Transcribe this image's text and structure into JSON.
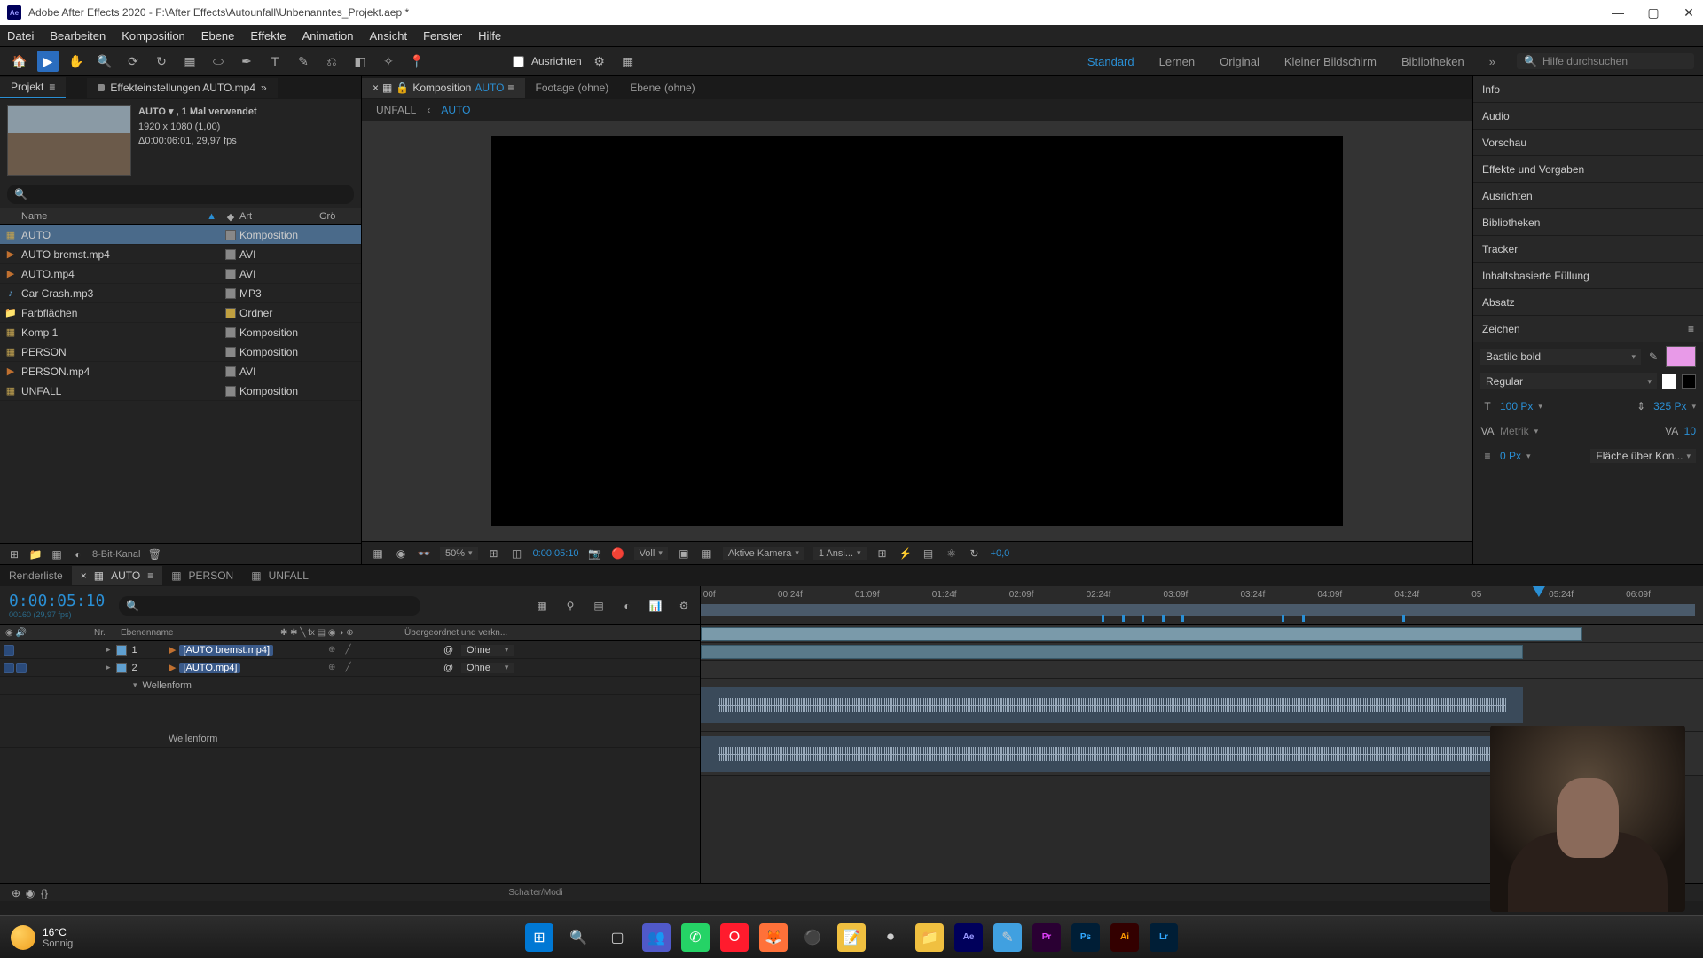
{
  "title": "Adobe After Effects 2020 - F:\\After Effects\\Autounfall\\Unbenanntes_Projekt.aep *",
  "menu": [
    "Datei",
    "Bearbeiten",
    "Komposition",
    "Ebene",
    "Effekte",
    "Animation",
    "Ansicht",
    "Fenster",
    "Hilfe"
  ],
  "toolbar": {
    "align_label": "Ausrichten"
  },
  "workspaces": {
    "items": [
      "Standard",
      "Lernen",
      "Original",
      "Kleiner Bildschirm",
      "Bibliotheken"
    ],
    "active": "Standard"
  },
  "search_placeholder": "Hilfe durchsuchen",
  "project": {
    "tab": "Projekt",
    "effects_tab": "Effekteinstellungen AUTO.mp4",
    "asset": {
      "name": "AUTO ▾ , 1 Mal verwendet",
      "dims": "1920 x 1080 (1,00)",
      "dur": "Δ0:00:06:01, 29,97 fps"
    },
    "cols": {
      "name": "Name",
      "tag": "◆",
      "type": "Art",
      "size": "Grö"
    },
    "items": [
      {
        "name": "AUTO",
        "type": "Komposition",
        "icon": "comp",
        "sel": true
      },
      {
        "name": "AUTO bremst.mp4",
        "type": "AVI",
        "icon": "vid"
      },
      {
        "name": "AUTO.mp4",
        "type": "AVI",
        "icon": "vid"
      },
      {
        "name": "Car Crash.mp3",
        "type": "MP3",
        "icon": "aud"
      },
      {
        "name": "Farbflächen",
        "type": "Ordner",
        "icon": "fold"
      },
      {
        "name": "Komp 1",
        "type": "Komposition",
        "icon": "comp"
      },
      {
        "name": "PERSON",
        "type": "Komposition",
        "icon": "comp"
      },
      {
        "name": "PERSON.mp4",
        "type": "AVI",
        "icon": "vid"
      },
      {
        "name": "UNFALL",
        "type": "Komposition",
        "icon": "comp"
      }
    ],
    "footer": "8-Bit-Kanal"
  },
  "comp": {
    "tabs": {
      "komposition": "Komposition",
      "active_comp": "AUTO",
      "footage": "Footage",
      "footage_val": "(ohne)",
      "ebene": "Ebene",
      "ebene_val": "(ohne)"
    },
    "bread": [
      "UNFALL",
      "AUTO"
    ],
    "footer": {
      "zoom": "50%",
      "time": "0:00:05:10",
      "res": "Voll",
      "cam": "Aktive Kamera",
      "views": "1 Ansi...",
      "exp": "+0,0"
    }
  },
  "right": {
    "panels": [
      "Info",
      "Audio",
      "Vorschau",
      "Effekte und Vorgaben",
      "Ausrichten",
      "Bibliotheken",
      "Tracker",
      "Inhaltsbasierte Füllung",
      "Absatz"
    ],
    "char": {
      "title": "Zeichen",
      "font": "Bastile bold",
      "style": "Regular",
      "size": "100 Px",
      "leading": "325 Px",
      "kerning": "Metrik",
      "tracking": "10",
      "stroke_w": "0 Px",
      "stroke_mode": "Fläche über Kon..."
    }
  },
  "timeline": {
    "tabs": [
      {
        "label": "Renderliste"
      },
      {
        "label": "AUTO",
        "active": true
      },
      {
        "label": "PERSON"
      },
      {
        "label": "UNFALL"
      }
    ],
    "timecode": "0:00:05:10",
    "subtc": "00160 (29,97 fps)",
    "cols": {
      "nr": "Nr.",
      "name": "Ebenenname",
      "parent": "Übergeordnet und verkn..."
    },
    "layers": [
      {
        "num": "1",
        "name": "[AUTO bremst.mp4]",
        "parent": "Ohne"
      },
      {
        "num": "2",
        "name": "[AUTO.mp4]",
        "parent": "Ohne"
      }
    ],
    "wave_label": "Wellenform",
    "wave_label2": "Wellenform",
    "ruler": [
      ":00f",
      "00:24f",
      "01:09f",
      "01:24f",
      "02:09f",
      "02:24f",
      "03:09f",
      "03:24f",
      "04:09f",
      "04:24f",
      "05",
      "05:24f",
      "06:09f"
    ],
    "footer": "Schalter/Modi"
  },
  "taskbar": {
    "temp": "16°C",
    "cond": "Sonnig"
  }
}
